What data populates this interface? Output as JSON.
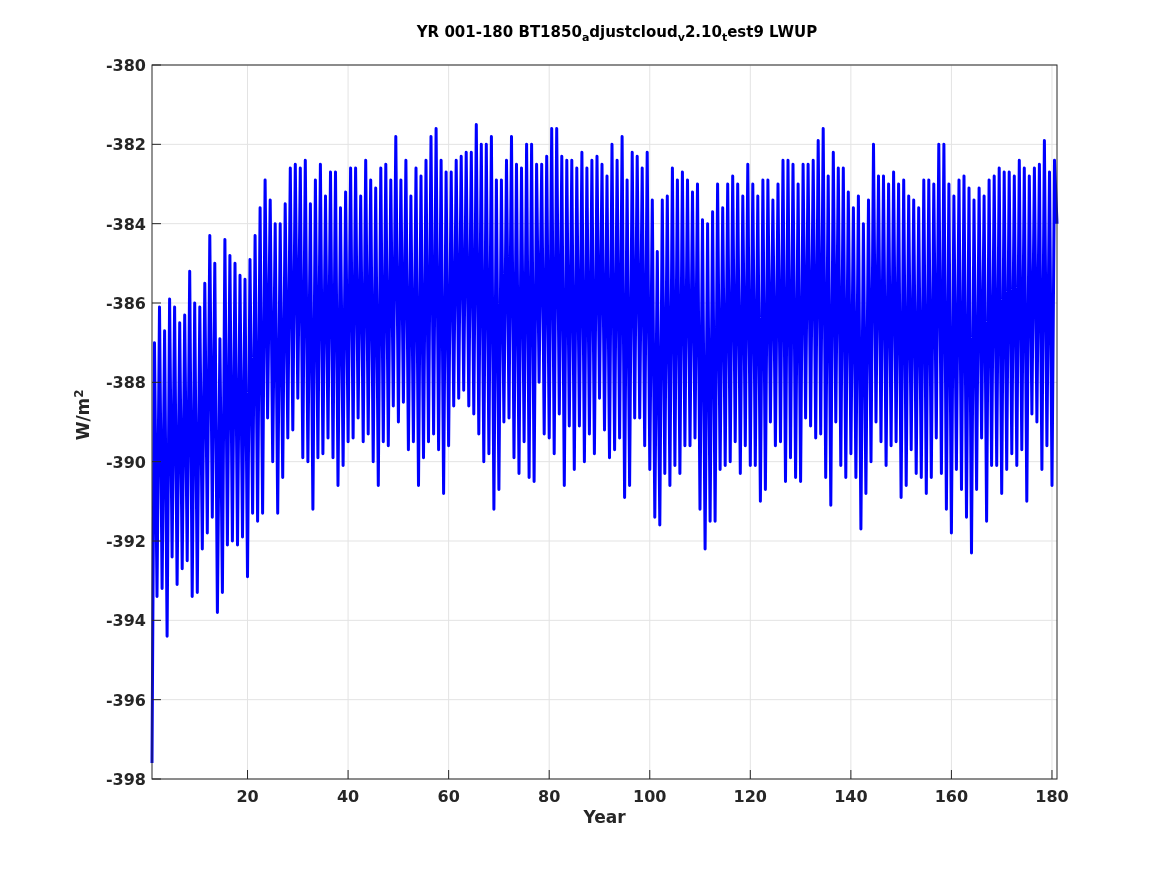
{
  "figure": {
    "chart_data": {
      "type": "line",
      "title": "YR 001-180 BT1850$_{a}$djustcloud$_{v}$2.10$_{t}$est9 LWUP",
      "xlabel": "Year",
      "ylabel": "W/m$^{2}$",
      "xlim": [
        1,
        181
      ],
      "ylim": [
        -398,
        -380
      ],
      "grid": true,
      "xticks": [
        20,
        40,
        60,
        80,
        100,
        120,
        140,
        160,
        180
      ],
      "yticks": [
        -398,
        -396,
        -394,
        -392,
        -390,
        -388,
        -386,
        -384,
        -382,
        -380
      ],
      "x": [
        1,
        1.5,
        2,
        2.5,
        3,
        3.5,
        4,
        4.5,
        5,
        5.5,
        6,
        6.5,
        7,
        7.5,
        8,
        8.5,
        9,
        9.5,
        10,
        10.5,
        11,
        11.5,
        12,
        12.5,
        13,
        13.5,
        14,
        14.5,
        15,
        15.5,
        16,
        16.5,
        17,
        17.5,
        18,
        18.5,
        19,
        19.5,
        20,
        20.5,
        21,
        21.5,
        22,
        22.5,
        23,
        23.5,
        24,
        24.5,
        25,
        25.5,
        26,
        26.5,
        27,
        27.5,
        28,
        28.5,
        29,
        29.5,
        30,
        30.5,
        31,
        31.5,
        32,
        32.5,
        33,
        33.5,
        34,
        34.5,
        35,
        35.5,
        36,
        36.5,
        37,
        37.5,
        38,
        38.5,
        39,
        39.5,
        40,
        40.5,
        41,
        41.5,
        42,
        42.5,
        43,
        43.5,
        44,
        44.5,
        45,
        45.5,
        46,
        46.5,
        47,
        47.5,
        48,
        48.5,
        49,
        49.5,
        50,
        50.5,
        51,
        51.5,
        52,
        52.5,
        53,
        53.5,
        54,
        54.5,
        55,
        55.5,
        56,
        56.5,
        57,
        57.5,
        58,
        58.5,
        59,
        59.5,
        60,
        60.5,
        61,
        61.5,
        62,
        62.5,
        63,
        63.5,
        64,
        64.5,
        65,
        65.5,
        66,
        66.5,
        67,
        67.5,
        68,
        68.5,
        69,
        69.5,
        70,
        70.5,
        71,
        71.5,
        72,
        72.5,
        73,
        73.5,
        74,
        74.5,
        75,
        75.5,
        76,
        76.5,
        77,
        77.5,
        78,
        78.5,
        79,
        79.5,
        80,
        80.5,
        81,
        81.5,
        82,
        82.5,
        83,
        83.5,
        84,
        84.5,
        85,
        85.5,
        86,
        86.5,
        87,
        87.5,
        88,
        88.5,
        89,
        89.5,
        90,
        90.5,
        91,
        91.5,
        92,
        92.5,
        93,
        93.5,
        94,
        94.5,
        95,
        95.5,
        96,
        96.5,
        97,
        97.5,
        98,
        98.5,
        99,
        99.5,
        100,
        100.5,
        101,
        101.5,
        102,
        102.5,
        103,
        103.5,
        104,
        104.5,
        105,
        105.5,
        106,
        106.5,
        107,
        107.5,
        108,
        108.5,
        109,
        109.5,
        110,
        110.5,
        111,
        111.5,
        112,
        112.5,
        113,
        113.5,
        114,
        114.5,
        115,
        115.5,
        116,
        116.5,
        117,
        117.5,
        118,
        118.5,
        119,
        119.5,
        120,
        120.5,
        121,
        121.5,
        122,
        122.5,
        123,
        123.5,
        124,
        124.5,
        125,
        125.5,
        126,
        126.5,
        127,
        127.5,
        128,
        128.5,
        129,
        129.5,
        130,
        130.5,
        131,
        131.5,
        132,
        132.5,
        133,
        133.5,
        134,
        134.5,
        135,
        135.5,
        136,
        136.5,
        137,
        137.5,
        138,
        138.5,
        139,
        139.5,
        140,
        140.5,
        141,
        141.5,
        142,
        142.5,
        143,
        143.5,
        144,
        144.5,
        145,
        145.5,
        146,
        146.5,
        147,
        147.5,
        148,
        148.5,
        149,
        149.5,
        150,
        150.5,
        151,
        151.5,
        152,
        152.5,
        153,
        153.5,
        154,
        154.5,
        155,
        155.5,
        156,
        156.5,
        157,
        157.5,
        158,
        158.5,
        159,
        159.5,
        160,
        160.5,
        161,
        161.5,
        162,
        162.5,
        163,
        163.5,
        164,
        164.5,
        165,
        165.5,
        166,
        166.5,
        167,
        167.5,
        168,
        168.5,
        169,
        169.5,
        170,
        170.5,
        171,
        171.5,
        172,
        172.5,
        173,
        173.5,
        174,
        174.5,
        175,
        175.5,
        176,
        176.5,
        177,
        177.5,
        178,
        178.5,
        179,
        179.5,
        180,
        180.5,
        181
      ],
      "series": [
        {
          "color": "#0000ff",
          "values": [
            -397.6,
            -387.0,
            -393.4,
            -386.1,
            -393.2,
            -386.7,
            -394.4,
            -385.9,
            -392.4,
            -386.1,
            -393.1,
            -386.5,
            -392.7,
            -386.3,
            -392.5,
            -385.2,
            -393.4,
            -386.0,
            -393.3,
            -386.1,
            -392.2,
            -385.5,
            -391.8,
            -384.3,
            -391.4,
            -385.0,
            -393.8,
            -386.9,
            -393.3,
            -384.4,
            -392.1,
            -384.8,
            -392.0,
            -385.0,
            -392.1,
            -385.3,
            -391.9,
            -385.4,
            -392.9,
            -384.9,
            -391.3,
            -384.3,
            -391.5,
            -383.6,
            -391.3,
            -382.9,
            -388.9,
            -383.4,
            -390.0,
            -384.0,
            -391.3,
            -384.0,
            -390.4,
            -383.5,
            -389.4,
            -382.6,
            -389.2,
            -382.5,
            -388.4,
            -382.6,
            -389.9,
            -382.4,
            -390.0,
            -383.5,
            -391.2,
            -382.9,
            -389.9,
            -382.5,
            -389.8,
            -383.3,
            -389.4,
            -382.7,
            -389.9,
            -382.7,
            -390.6,
            -383.6,
            -390.1,
            -383.2,
            -389.5,
            -382.6,
            -389.4,
            -382.6,
            -388.9,
            -383.3,
            -389.5,
            -382.4,
            -389.3,
            -382.9,
            -390.0,
            -383.1,
            -390.6,
            -382.6,
            -389.5,
            -382.5,
            -389.6,
            -382.9,
            -388.6,
            -381.8,
            -389.0,
            -382.9,
            -388.5,
            -382.4,
            -389.7,
            -383.3,
            -389.5,
            -382.6,
            -390.6,
            -382.8,
            -389.9,
            -382.4,
            -389.5,
            -381.8,
            -389.3,
            -381.6,
            -389.7,
            -382.4,
            -390.8,
            -382.7,
            -389.6,
            -382.7,
            -388.6,
            -382.4,
            -388.4,
            -382.3,
            -388.2,
            -382.2,
            -388.6,
            -382.2,
            -388.8,
            -381.5,
            -389.3,
            -382.0,
            -390.0,
            -382.0,
            -389.8,
            -381.8,
            -391.2,
            -382.9,
            -390.7,
            -382.9,
            -389.0,
            -382.4,
            -388.9,
            -381.8,
            -389.9,
            -382.5,
            -390.3,
            -382.6,
            -389.5,
            -382.0,
            -390.4,
            -382.0,
            -390.5,
            -382.5,
            -388.0,
            -382.5,
            -389.3,
            -382.3,
            -389.4,
            -381.6,
            -389.8,
            -381.6,
            -388.8,
            -382.3,
            -390.6,
            -382.4,
            -389.1,
            -382.4,
            -390.2,
            -382.6,
            -389.1,
            -382.2,
            -390.0,
            -382.6,
            -389.3,
            -382.4,
            -389.8,
            -382.3,
            -388.4,
            -382.5,
            -389.2,
            -382.8,
            -389.9,
            -382.0,
            -389.7,
            -382.4,
            -389.4,
            -381.8,
            -390.9,
            -382.9,
            -390.6,
            -382.2,
            -388.9,
            -382.3,
            -388.9,
            -382.6,
            -389.6,
            -382.2,
            -390.2,
            -383.4,
            -391.4,
            -384.7,
            -391.6,
            -383.4,
            -390.3,
            -383.3,
            -390.6,
            -382.6,
            -390.1,
            -382.9,
            -390.3,
            -382.7,
            -389.6,
            -382.9,
            -389.6,
            -383.2,
            -389.4,
            -383.0,
            -391.2,
            -383.9,
            -392.2,
            -384.0,
            -391.5,
            -383.7,
            -391.5,
            -383.0,
            -390.2,
            -383.6,
            -390.1,
            -383.0,
            -390.0,
            -382.8,
            -389.5,
            -383.0,
            -390.3,
            -383.3,
            -389.6,
            -382.5,
            -390.1,
            -383.0,
            -390.1,
            -383.3,
            -391.0,
            -382.9,
            -390.7,
            -382.9,
            -389.0,
            -383.4,
            -389.6,
            -383.0,
            -389.5,
            -382.4,
            -390.5,
            -382.4,
            -389.9,
            -382.5,
            -390.4,
            -383.0,
            -390.5,
            -382.5,
            -388.9,
            -382.5,
            -389.1,
            -382.4,
            -389.4,
            -381.9,
            -389.3,
            -381.6,
            -390.4,
            -382.8,
            -391.1,
            -382.2,
            -389.0,
            -382.6,
            -390.1,
            -382.6,
            -390.4,
            -383.2,
            -389.8,
            -383.6,
            -390.4,
            -383.3,
            -391.7,
            -384.0,
            -390.8,
            -383.4,
            -390.0,
            -382.0,
            -389.0,
            -382.8,
            -389.5,
            -382.8,
            -390.1,
            -383.0,
            -389.6,
            -382.7,
            -389.5,
            -383.0,
            -390.9,
            -382.9,
            -390.6,
            -383.3,
            -389.7,
            -383.4,
            -390.3,
            -383.6,
            -390.4,
            -382.9,
            -390.8,
            -382.9,
            -390.4,
            -383.0,
            -389.4,
            -382.0,
            -390.3,
            -382.0,
            -391.2,
            -383.0,
            -391.8,
            -383.3,
            -390.2,
            -382.9,
            -390.7,
            -382.8,
            -391.4,
            -383.1,
            -392.3,
            -383.4,
            -390.7,
            -383.1,
            -389.4,
            -383.3,
            -391.5,
            -382.9,
            -390.1,
            -382.8,
            -390.1,
            -382.6,
            -390.8,
            -382.7,
            -390.2,
            -382.7,
            -389.8,
            -382.8,
            -390.1,
            -382.4,
            -389.7,
            -382.6,
            -391.0,
            -382.8,
            -388.8,
            -382.6,
            -389.0,
            -382.5,
            -390.2,
            -381.9,
            -389.6,
            -382.7,
            -390.6,
            -382.4,
            -384.0
          ]
        }
      ]
    }
  }
}
